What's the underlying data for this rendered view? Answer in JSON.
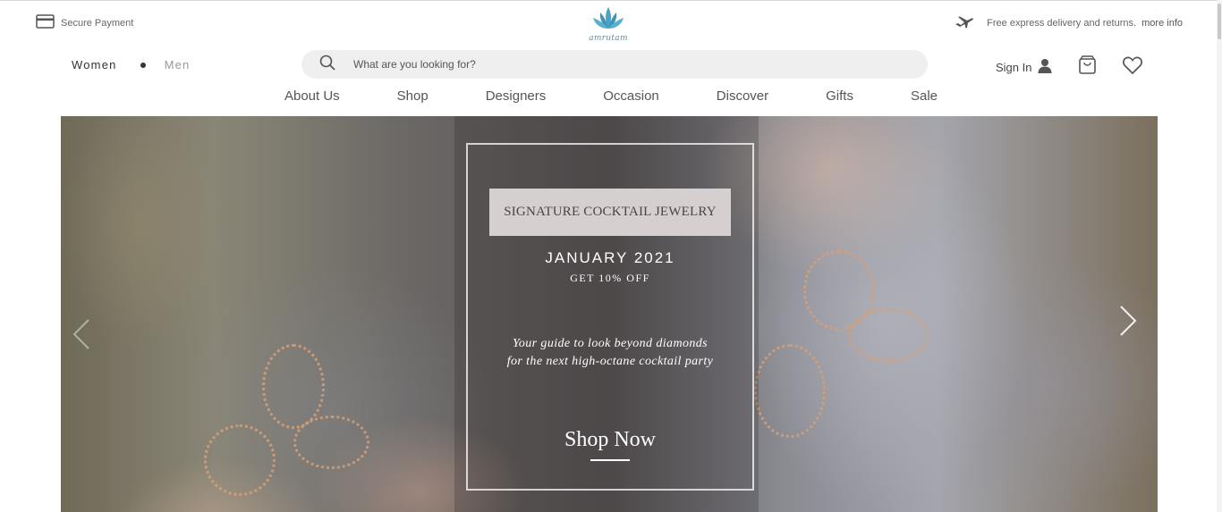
{
  "topbar": {
    "secure_payment": "Secure Payment",
    "delivery_text": "Free express delivery and returns.",
    "more_info": "more info",
    "logo_text": "amrutam"
  },
  "gender": {
    "women": "Women",
    "men": "Men"
  },
  "search": {
    "placeholder": "What are you looking for?"
  },
  "account": {
    "sign_in": "Sign In"
  },
  "nav": {
    "items": [
      {
        "label": "About Us"
      },
      {
        "label": "Shop"
      },
      {
        "label": "Designers"
      },
      {
        "label": "Occasion"
      },
      {
        "label": "Discover"
      },
      {
        "label": "Gifts"
      },
      {
        "label": "Sale"
      }
    ]
  },
  "hero": {
    "collection": "SIGNATURE COCKTAIL JEWELRY",
    "date": "JANUARY 2021",
    "offer": "GET 10% OFF",
    "tagline_1": "Your guide to look beyond diamonds",
    "tagline_2": "for the next high-octane cocktail party",
    "cta": "Shop Now"
  },
  "colors": {
    "accent_logo": "#4aa3c4",
    "label_box": "#d6cfd0",
    "search_bg": "#efefef"
  },
  "icons": [
    "card-icon",
    "lotus-logo-icon",
    "plane-icon",
    "search-icon",
    "user-icon",
    "bag-icon",
    "heart-icon",
    "chevron-left-icon",
    "chevron-right-icon"
  ]
}
